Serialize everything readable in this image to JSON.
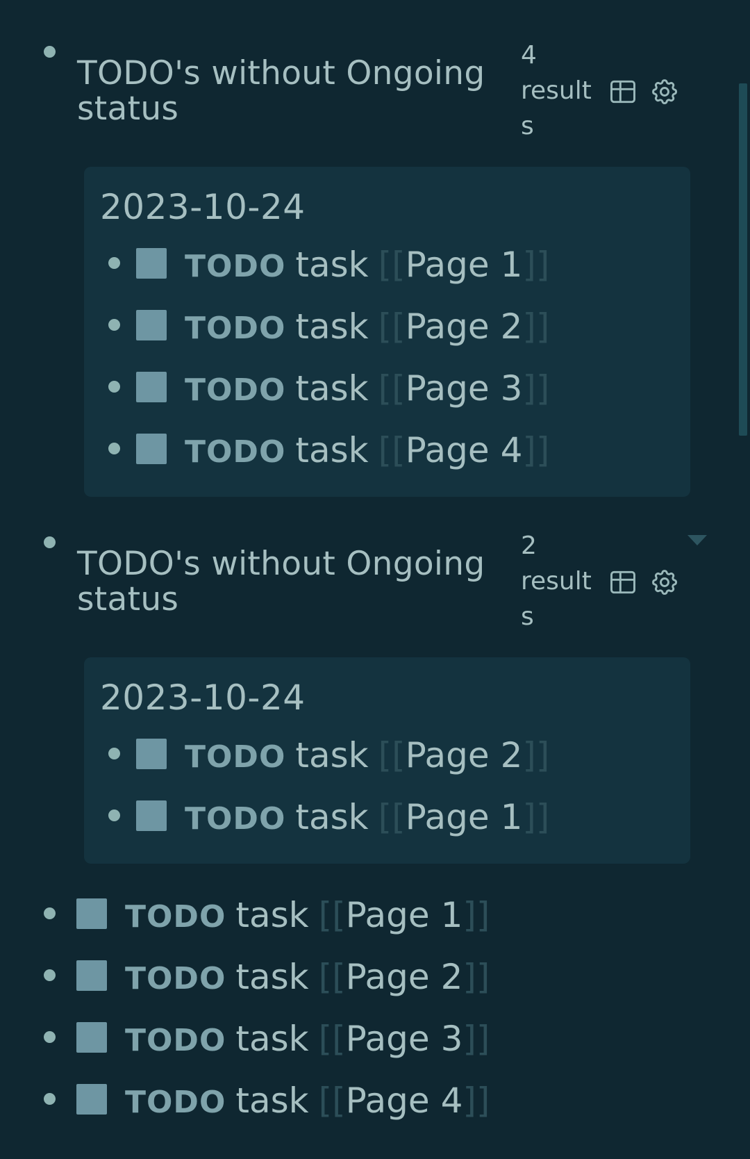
{
  "queries": [
    {
      "title": "TODO's without Ongoing status",
      "count_lines": [
        "4",
        "result",
        "s"
      ],
      "date": "2023-10-24",
      "tasks": [
        {
          "marker": "TODO",
          "text": "task",
          "page": "Page 1"
        },
        {
          "marker": "TODO",
          "text": "task",
          "page": "Page 2"
        },
        {
          "marker": "TODO",
          "text": "task",
          "page": "Page 3"
        },
        {
          "marker": "TODO",
          "text": "task",
          "page": "Page 4"
        }
      ]
    },
    {
      "title": "TODO's without Ongoing status",
      "count_lines": [
        "2",
        "result",
        "s"
      ],
      "date": "2023-10-24",
      "tasks": [
        {
          "marker": "TODO",
          "text": "task",
          "page": "Page 2"
        },
        {
          "marker": "TODO",
          "text": "task",
          "page": "Page 1"
        }
      ]
    }
  ],
  "root_tasks": [
    {
      "marker": "TODO",
      "text": "task",
      "page": "Page 1"
    },
    {
      "marker": "TODO",
      "text": "task",
      "page": "Page 2"
    },
    {
      "marker": "TODO",
      "text": "task",
      "page": "Page 3"
    },
    {
      "marker": "TODO",
      "text": "task",
      "page": "Page 4"
    }
  ],
  "brackets": {
    "open": "[[",
    "close": "]]"
  },
  "icons": {
    "table": "table-icon",
    "settings": "gear-icon",
    "collapse": "caret-down-icon"
  },
  "colors": {
    "background": "#0f2731",
    "panel": "#14333f",
    "text": "#a6bfc1",
    "checkbox": "#6e96a3",
    "bracket": "#2c4e58"
  }
}
